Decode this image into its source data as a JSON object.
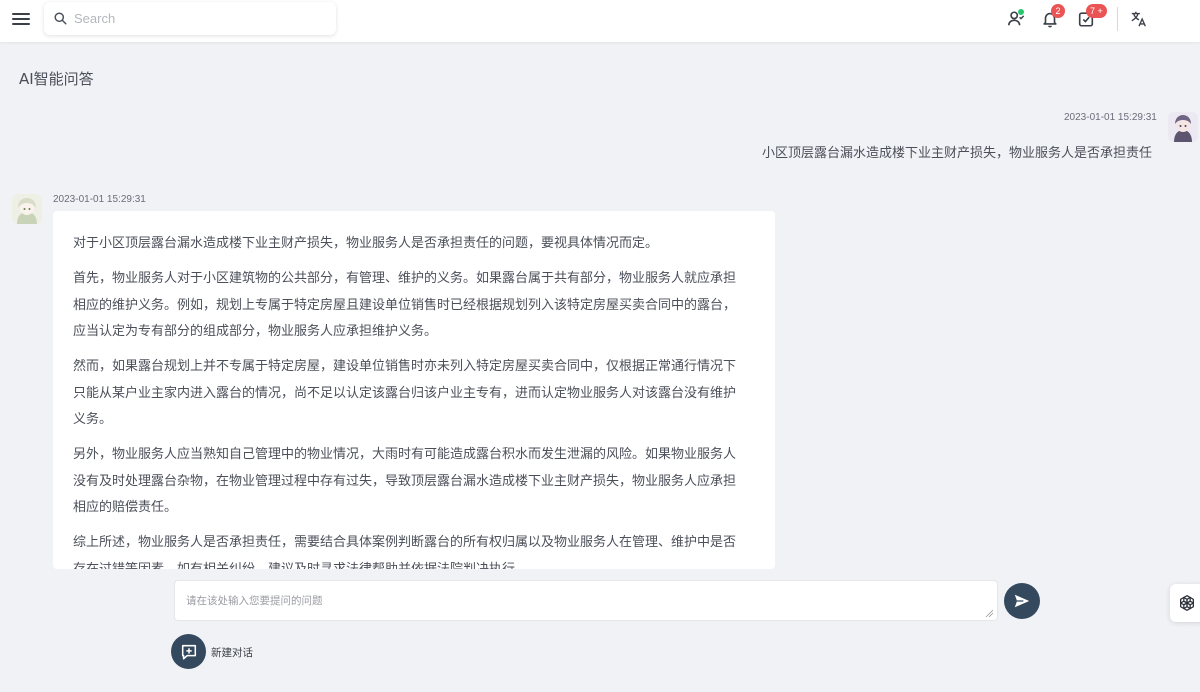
{
  "header": {
    "search_placeholder": "Search",
    "notifications_count": "2",
    "tasks_count": "7 +"
  },
  "page": {
    "title": "AI智能问答"
  },
  "chat": {
    "user_message": {
      "timestamp": "2023-01-01 15:29:31",
      "text": "小区顶层露台漏水造成楼下业主财产损失，物业服务人是否承担责任"
    },
    "ai_message": {
      "timestamp": "2023-01-01 15:29:31",
      "paragraphs": [
        "对于小区顶层露台漏水造成楼下业主财产损失，物业服务人是否承担责任的问题，要视具体情况而定。",
        "首先，物业服务人对于小区建筑物的公共部分，有管理、维护的义务。如果露台属于共有部分，物业服务人就应承担相应的维护义务。例如，规划上专属于特定房屋且建设单位销售时已经根据规划列入该特定房屋买卖合同中的露台，应当认定为专有部分的组成部分，物业服务人应承担维护义务。",
        "然而，如果露台规划上并不专属于特定房屋，建设单位销售时亦未列入特定房屋买卖合同中，仅根据正常通行情况下只能从某户业主家内进入露台的情况，尚不足以认定该露台归该户业主专有，进而认定物业服务人对该露台没有维护义务。",
        "另外，物业服务人应当熟知自己管理中的物业情况，大雨时有可能造成露台积水而发生泄漏的风险。如果物业服务人没有及时处理露台杂物，在物业管理过程中存有过失，导致顶层露台漏水造成楼下业主财产损失，物业服务人应承担相应的赔偿责任。",
        "综上所述，物业服务人是否承担责任，需要结合具体案例判断露台的所有权归属以及物业服务人在管理、维护中是否存在过错等因素。如有相关纠纷，建议及时寻求法律帮助并依据法院判决执行。"
      ]
    }
  },
  "composer": {
    "placeholder": "请在该处输入您要提问的问题",
    "new_chat_label": "新建对话"
  },
  "colors": {
    "accent_dark": "#34495e",
    "badge_red": "#ea5455",
    "online_green": "#28c76f",
    "background": "#f0f2f5"
  },
  "icons": [
    "menu-icon",
    "search-icon",
    "users-icon",
    "bell-icon",
    "task-check-icon",
    "translate-icon",
    "send-icon",
    "new-chat-icon",
    "openai-icon"
  ]
}
